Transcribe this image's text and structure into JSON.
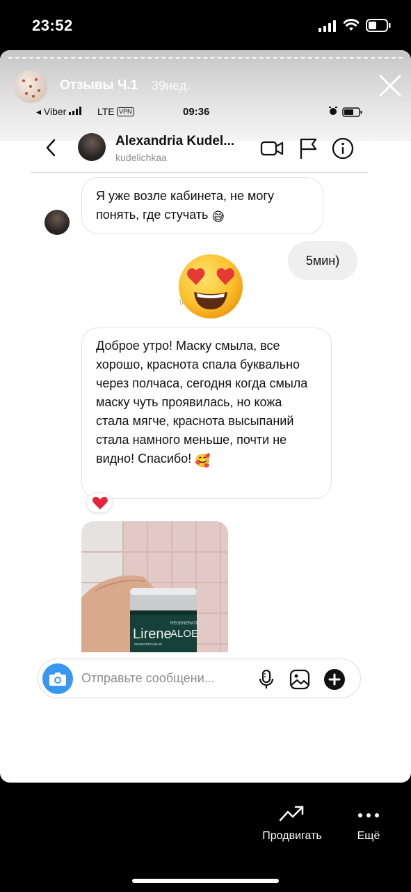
{
  "device_status": {
    "time": "23:52"
  },
  "story": {
    "title": "Отзывы Ч.1",
    "time_ago": "39нед.",
    "close_icon": "close-icon"
  },
  "inner_status": {
    "carrier": "◂ Viber",
    "network": "LTE",
    "vpn": "VPN",
    "time": "09:36"
  },
  "chat_header": {
    "name": "Alexandria Kudel...",
    "username": "kudelichkaa",
    "icons": [
      "back-chevron-icon",
      "video-call-icon",
      "flag-icon",
      "info-icon"
    ]
  },
  "messages": {
    "m1": {
      "text": "Я уже возле кабинета, не могу понять, где стучать",
      "emoji": "😅"
    },
    "m2": {
      "text": "5мин)"
    },
    "m3_emoji": "heart-eyes-emoji",
    "m3_hidden_char": "9",
    "m4": {
      "text": "Доброе утро! Маску смыла, все хорошо, краснота спала буквально через полчаса, сегодня когда смыла маску чуть проявилась, но кожа стала мягче, краснота высыпаний стала намного меньше, почти не видно! Спасибо!",
      "emoji": "🥰"
    },
    "m4_reaction": "❤️",
    "photo": {
      "brand": "Lirene",
      "product": "ALOE",
      "subtitle": "REGENERATING",
      "tagline": "DERMOPROGRAM"
    }
  },
  "composer": {
    "placeholder": "Отправьте сообщени...",
    "icons": [
      "camera-icon",
      "microphone-icon",
      "gallery-icon",
      "plus-icon"
    ]
  },
  "bottom_bar": {
    "promote_label": "Продвигать",
    "more_label": "Ещё"
  },
  "colors": {
    "accent": "#3897f0",
    "background": "#000000",
    "bubble_border": "#e3e3e3"
  }
}
